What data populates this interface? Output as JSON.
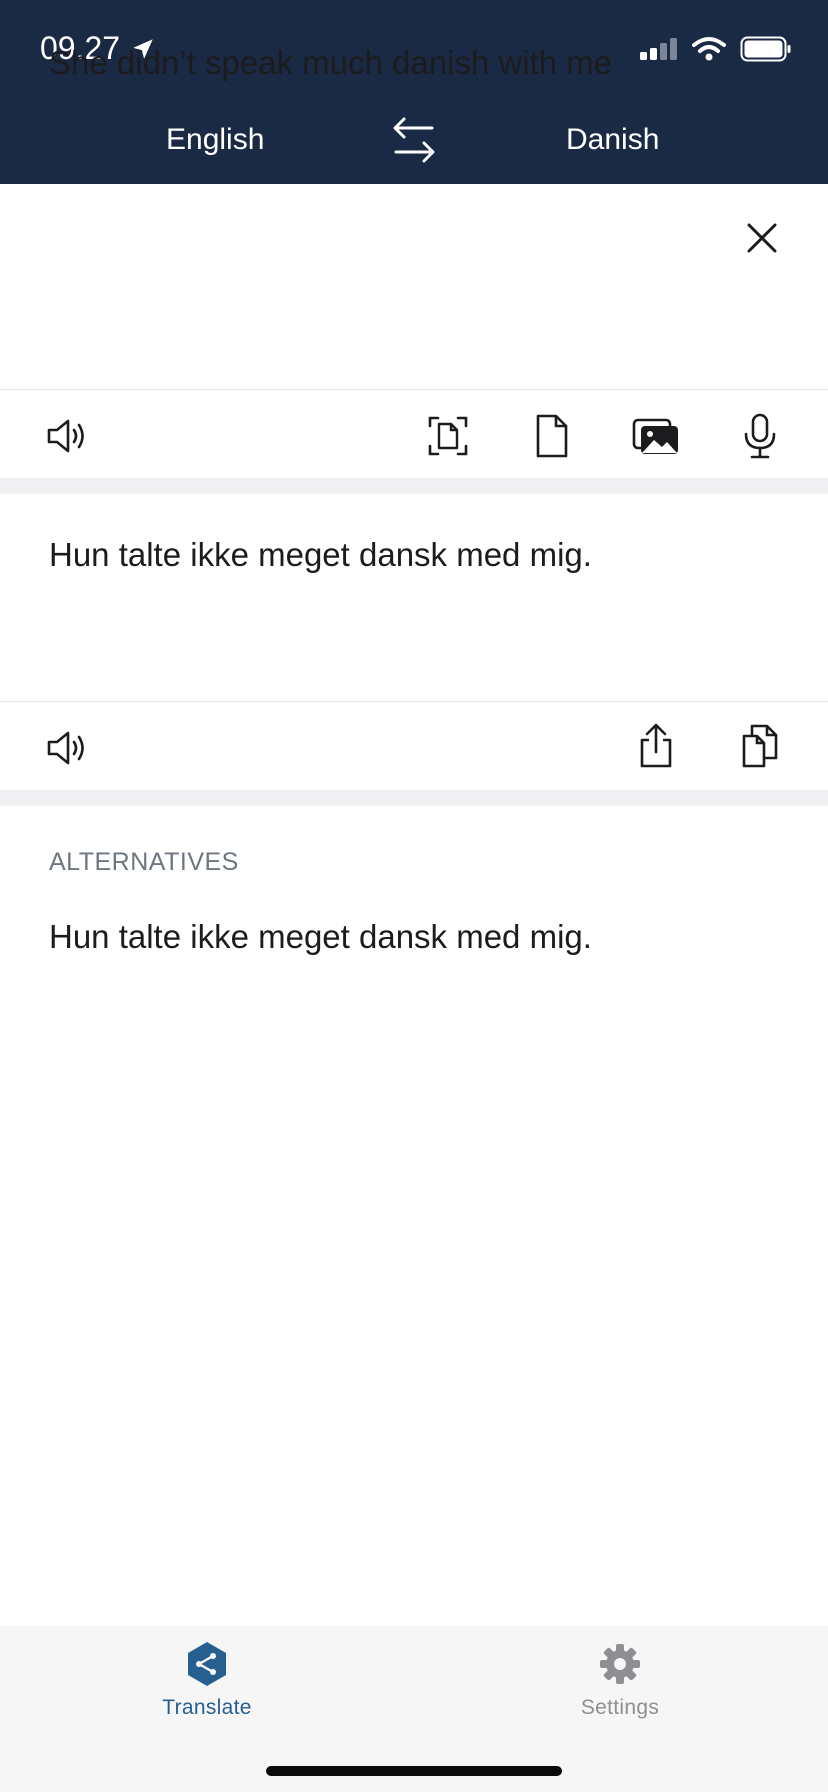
{
  "status_bar": {
    "time": "09.27",
    "icons": [
      "location-arrow-icon",
      "cellular-signal-icon",
      "wifi-icon",
      "battery-icon"
    ]
  },
  "languages": {
    "source": "English",
    "target": "Danish",
    "swap_icon": "swap-arrows-icon"
  },
  "input": {
    "text": "She didn’t speak much danish with me",
    "clear_icon": "close-icon"
  },
  "input_toolbar": {
    "icons": [
      "speaker-icon",
      "scan-document-icon",
      "document-icon",
      "photo-gallery-icon",
      "microphone-icon"
    ]
  },
  "output": {
    "text": "Hun talte ikke meget dansk med mig."
  },
  "output_toolbar": {
    "icons": [
      "speaker-icon",
      "share-icon",
      "copy-icon"
    ]
  },
  "alternatives": {
    "title": "ALTERNATIVES",
    "items": [
      "Hun talte ikke meget dansk med mig."
    ]
  },
  "tab_bar": {
    "tabs": [
      {
        "label": "Translate",
        "icon": "translate-logo-icon",
        "active": true
      },
      {
        "label": "Settings",
        "icon": "gear-icon",
        "active": false
      }
    ]
  },
  "colors": {
    "header_bg": "#1a2a44",
    "accent": "#27608f",
    "muted": "#8e8e93",
    "band": "#f0f0f2"
  }
}
